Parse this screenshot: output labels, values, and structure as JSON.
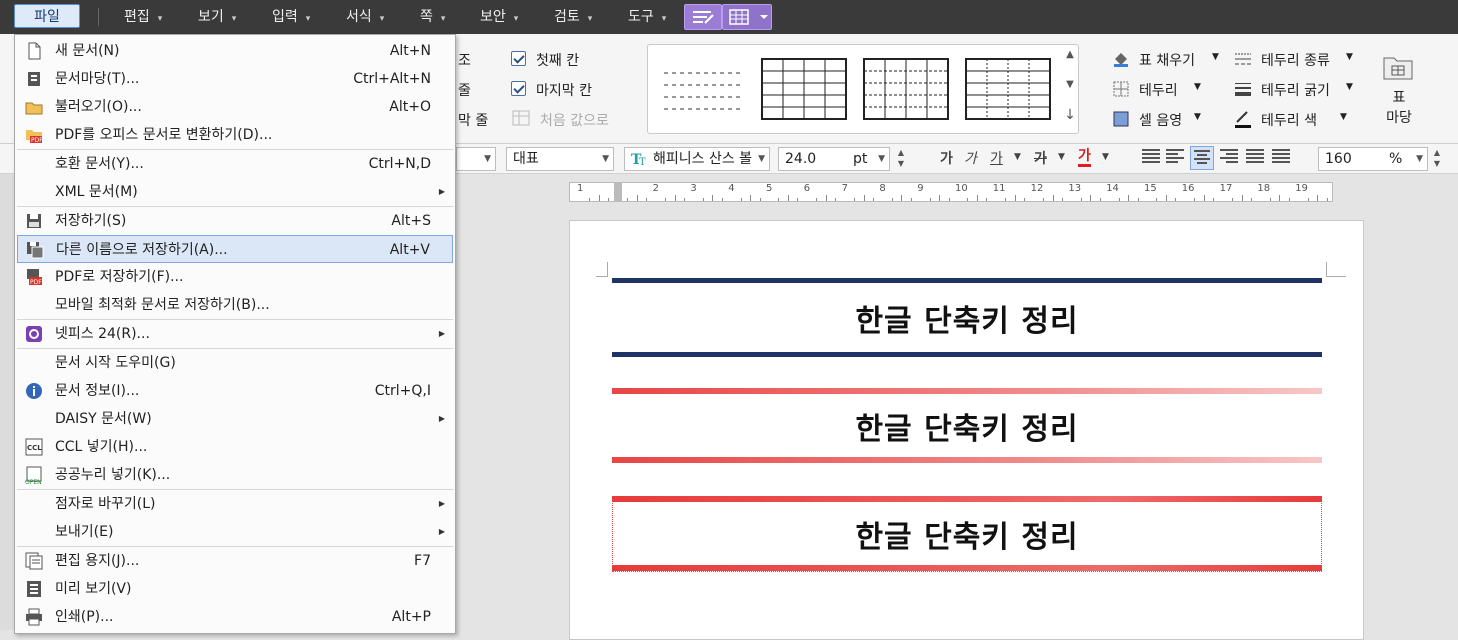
{
  "menubar": {
    "file": "파일",
    "items": [
      "편집",
      "보기",
      "입력",
      "서식",
      "쪽",
      "보안",
      "검토",
      "도구"
    ]
  },
  "ribbon": {
    "cut_left": [
      "조",
      "줄",
      "막 줄"
    ],
    "first_col": "첫째 칸",
    "last_col": "마지막 칸",
    "reset_values": "처음 값으로",
    "fill": "표 채우기",
    "border": "테두리",
    "cell_shade": "셀 음영",
    "border_type": "테두리 종류",
    "border_width": "테두리 굵기",
    "border_color": "테두리 색",
    "table_style": "표\n마당"
  },
  "format": {
    "style": "대표",
    "font": "해피니스 산스 볼",
    "size": "24.0",
    "unit": "pt",
    "zoom": "160",
    "zoom_unit": "%",
    "char_ga1": "가",
    "char_ga2": "가",
    "char_ga3": "가",
    "char_ga4": "가",
    "char_ga5": "가"
  },
  "ruler": {
    "numbers": [
      "1",
      "1",
      "2",
      "3",
      "4",
      "5",
      "6",
      "7",
      "8",
      "9",
      "10",
      "11",
      "12",
      "13",
      "14",
      "15",
      "16",
      "17",
      "18",
      "19"
    ]
  },
  "document": {
    "title1": "한글 단축키 정리",
    "title2": "한글 단축키 정리",
    "title3": "한글 단축키 정리"
  },
  "file_menu": [
    {
      "label": "새 문서(N)",
      "shortcut": "Alt+N",
      "icon": "new-doc-icon"
    },
    {
      "label": "문서마당(T)...",
      "shortcut": "Ctrl+Alt+N",
      "icon": "template-icon"
    },
    {
      "label": "불러오기(O)...",
      "shortcut": "Alt+O",
      "icon": "open-folder-icon"
    },
    {
      "label": "PDF를 오피스 문서로 변환하기(D)...",
      "shortcut": "",
      "icon": "pdf-convert-icon"
    },
    {
      "label": "호환 문서(Y)...",
      "shortcut": "Ctrl+N,D",
      "icon": ""
    },
    {
      "label": "XML 문서(M)",
      "shortcut": "",
      "icon": "",
      "submenu": true
    },
    {
      "label": "저장하기(S)",
      "shortcut": "Alt+S",
      "icon": "save-icon"
    },
    {
      "label": "다른 이름으로 저장하기(A)...",
      "shortcut": "Alt+V",
      "icon": "save-as-icon"
    },
    {
      "label": "PDF로 저장하기(F)...",
      "shortcut": "",
      "icon": "save-pdf-icon"
    },
    {
      "label": "모바일 최적화 문서로 저장하기(B)...",
      "shortcut": "",
      "icon": ""
    },
    {
      "label": "넷피스 24(R)...",
      "shortcut": "",
      "icon": "netffice-icon",
      "submenu": true
    },
    {
      "label": "문서 시작 도우미(G)",
      "shortcut": "",
      "icon": ""
    },
    {
      "label": "문서 정보(I)...",
      "shortcut": "Ctrl+Q,I",
      "icon": "info-icon"
    },
    {
      "label": "DAISY 문서(W)",
      "shortcut": "",
      "icon": "",
      "submenu": true
    },
    {
      "label": "CCL 넣기(H)...",
      "shortcut": "",
      "icon": "ccl-icon"
    },
    {
      "label": "공공누리 넣기(K)...",
      "shortcut": "",
      "icon": "open-license-icon"
    },
    {
      "label": "점자로 바꾸기(L)",
      "shortcut": "",
      "icon": "",
      "submenu": true
    },
    {
      "label": "보내기(E)",
      "shortcut": "",
      "icon": "",
      "submenu": true
    },
    {
      "label": "편집 용지(J)...",
      "shortcut": "F7",
      "icon": "page-setup-icon"
    },
    {
      "label": "미리 보기(V)",
      "shortcut": "",
      "icon": "preview-icon"
    },
    {
      "label": "인쇄(P)...",
      "shortcut": "Alt+P",
      "icon": "print-icon"
    }
  ]
}
